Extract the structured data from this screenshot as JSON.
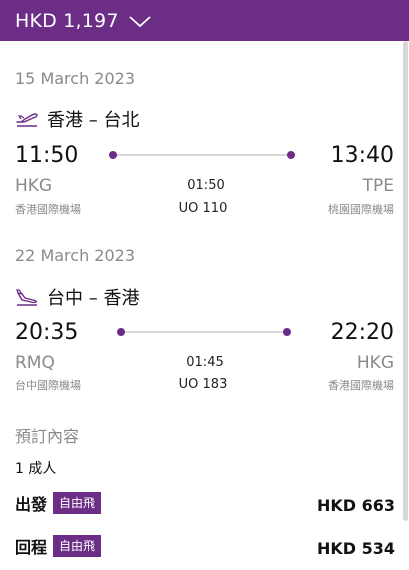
{
  "header": {
    "price": "HKD 1,197"
  },
  "outbound": {
    "date": "15 March 2023",
    "route": "香港 – 台北",
    "depart_time": "11:50",
    "arrive_time": "13:40",
    "depart_code": "HKG",
    "arrive_code": "TPE",
    "depart_airport": "香港國際機場",
    "arrive_airport": "桃園國際機場",
    "duration": "01:50",
    "flight": "UO 110"
  },
  "inbound": {
    "date": "22 March 2023",
    "route": "台中 – 香港",
    "depart_time": "20:35",
    "arrive_time": "22:20",
    "depart_code": "RMQ",
    "arrive_code": "HKG",
    "depart_airport": "台中國際機場",
    "arrive_airport": "香港國際機場",
    "duration": "01:45",
    "flight": "UO 183"
  },
  "booking": {
    "title": "預訂內容",
    "passengers": "1 成人",
    "outbound_label": "出發",
    "outbound_badge": "自由飛",
    "outbound_price": "HKD 663",
    "return_label": "回程",
    "return_badge": "自由飛",
    "return_price": "HKD 534"
  },
  "colors": {
    "accent": "#6b2d86",
    "muted": "#8a8a8a"
  },
  "icons": {
    "takeoff": "plane-takeoff-icon",
    "landing": "plane-landing-icon",
    "chevron": "chevron-down-icon"
  }
}
